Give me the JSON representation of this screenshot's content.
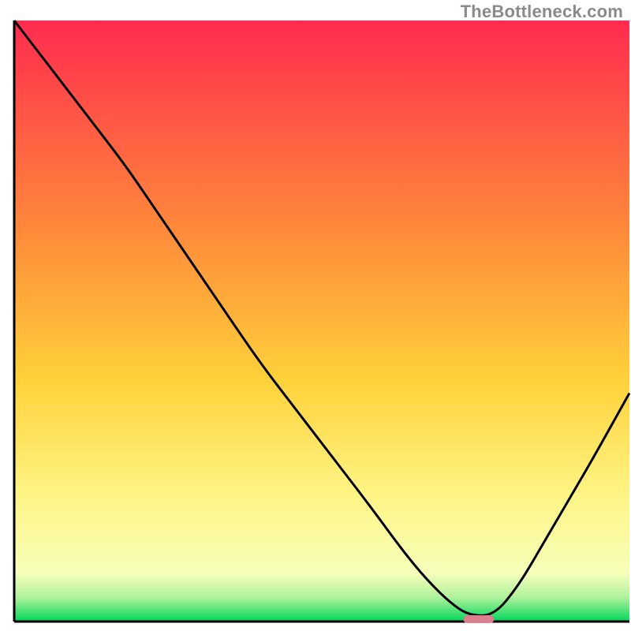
{
  "watermark": "TheBottleneck.com",
  "colors": {
    "gradient_top": "#ff2b4f",
    "gradient_mid1": "#ff8a3a",
    "gradient_mid2": "#ffd23a",
    "gradient_mid3": "#fff68a",
    "gradient_bottom": "#00d65a",
    "curve": "#000000",
    "axis": "#000000",
    "marker": "#d9808c"
  },
  "chart_data": {
    "type": "line",
    "title": "",
    "xlabel": "",
    "ylabel": "",
    "xlim": [
      0,
      100
    ],
    "ylim": [
      0,
      100
    ],
    "series": [
      {
        "name": "bottleneck-curve",
        "x": [
          0,
          6,
          12,
          18,
          22,
          28,
          34,
          40,
          46,
          52,
          58,
          63,
          67,
          71,
          74,
          78,
          82,
          86,
          90,
          94,
          100
        ],
        "y": [
          100,
          92,
          84,
          76,
          70,
          61,
          52,
          43,
          35,
          27,
          19,
          12,
          7,
          3,
          1,
          1,
          6,
          13,
          20,
          27,
          38
        ]
      }
    ],
    "marker": {
      "name": "optimal-region",
      "x_start": 73,
      "x_end": 78,
      "y": 0.5
    },
    "gradient_stops_percent": [
      0,
      35,
      60,
      80,
      92,
      96,
      100
    ],
    "legend": [],
    "grid": false
  }
}
